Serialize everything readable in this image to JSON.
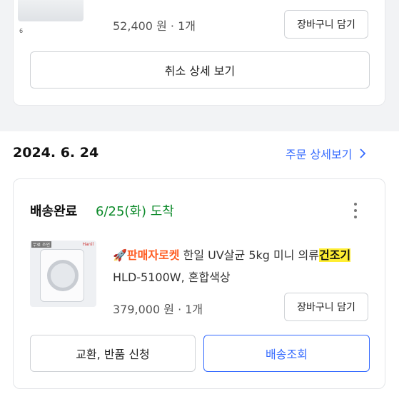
{
  "prev_order": {
    "thumb_tag": "6",
    "price": "52,400 원",
    "quantity": "1개",
    "cart_button": "장바구니 담기",
    "cancel_detail_button": "취소 상세 보기"
  },
  "order": {
    "date": "2024. 6. 24",
    "detail_link": "주문 상세보기",
    "status": "배송완료",
    "arrival": "6/25(화) 도착",
    "product": {
      "badge_rocket": "🚀판매자로켓",
      "name_pre": " 한일 UV살균 5kg 미니 의류",
      "name_highlight": "건조기",
      "name_post": " HLD-5100W, 혼합색상",
      "thumb_badge": "무료 조언",
      "price": "379,000 원",
      "quantity": "1개"
    },
    "cart_button": "장바구니 담기",
    "exchange_button": "교환, 반품 신청",
    "tracking_button": "배송조회"
  },
  "colors": {
    "link": "#346aff",
    "arrival": "#0c8a2a",
    "highlight": "#ffee33",
    "rocket": "#ff5a1f"
  }
}
